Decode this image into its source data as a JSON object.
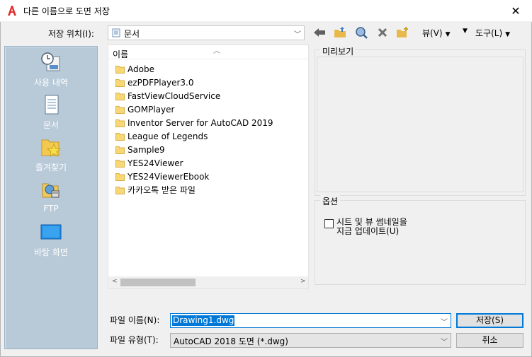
{
  "window": {
    "title": "다른 이름으로 도면 저장",
    "close_glyph": "✕"
  },
  "toolbar": {
    "location_label": "저장 위치(I):",
    "location_value": "문서",
    "view_menu": "뷰(V)",
    "tools_menu": "도구(L)",
    "icons": [
      "back-icon",
      "up-folder-icon",
      "search-web-icon",
      "delete-icon",
      "new-folder-icon"
    ]
  },
  "places": [
    {
      "label": "사용 내역",
      "icon": "history-icon"
    },
    {
      "label": "문서",
      "icon": "documents-icon"
    },
    {
      "label": "즐겨찾기",
      "icon": "favorites-icon"
    },
    {
      "label": "FTP",
      "icon": "ftp-icon"
    },
    {
      "label": "바탕 화면",
      "icon": "desktop-icon"
    }
  ],
  "file_list": {
    "column_header": "이름",
    "items": [
      "Adobe",
      "ezPDFPlayer3.0",
      "FastViewCloudService",
      "GOMPlayer",
      "Inventor Server for AutoCAD 2019",
      "League of Legends",
      "Sample9",
      "YES24Viewer",
      "YES24ViewerEbook",
      "카카오톡 받은 파일"
    ]
  },
  "preview": {
    "label": "미리보기"
  },
  "options": {
    "label": "옵션",
    "checkbox_line1": "시트 및 뷰 썸네일을",
    "checkbox_line2": "지금 업데이트(U)",
    "checked": false
  },
  "footer": {
    "filename_label": "파일 이름(N):",
    "filename_value": "Drawing1.dwg",
    "filetype_label": "파일 유형(T):",
    "filetype_value": "AutoCAD 2018 도면 (*.dwg)",
    "save_button": "저장(S)",
    "cancel_button": "취소"
  },
  "colors": {
    "accent": "#0078d7",
    "places_bg": "#b8c9d8",
    "folder": "#f8d775",
    "logo": "#e03030"
  }
}
